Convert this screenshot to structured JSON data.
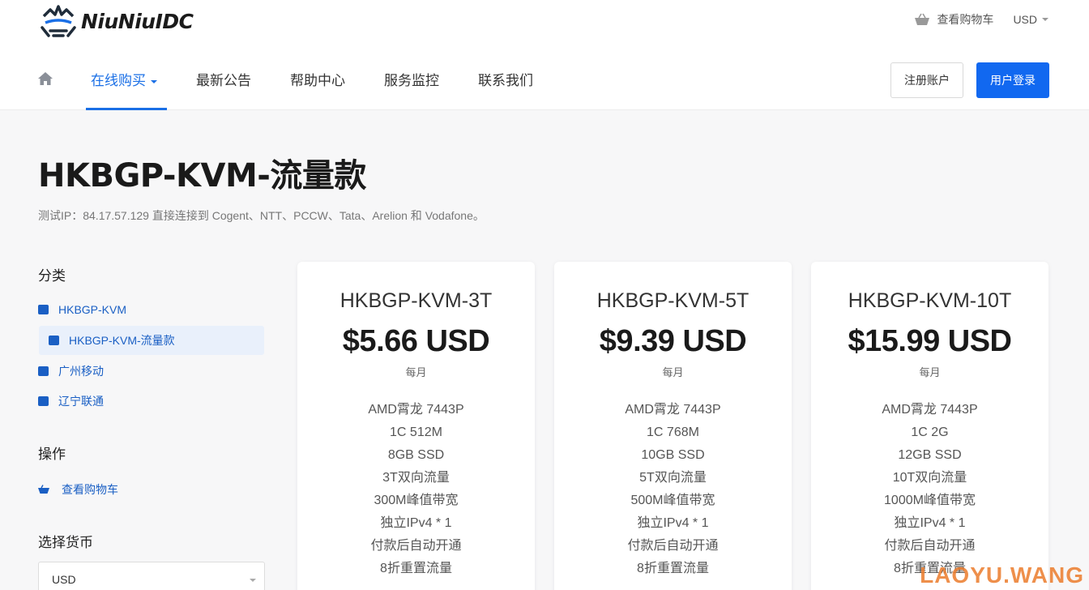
{
  "brand": {
    "name": "NiuNiuIDC"
  },
  "top_links": {
    "cart": "查看购物车",
    "currency": "USD"
  },
  "nav": {
    "items": [
      {
        "label": "在线购买"
      },
      {
        "label": "最新公告"
      },
      {
        "label": "帮助中心"
      },
      {
        "label": "服务监控"
      },
      {
        "label": "联系我们"
      }
    ],
    "register": "注册账户",
    "login": "用户登录"
  },
  "page": {
    "title": "HKBGP-KVM-流量款",
    "subtitle": "测试IP：84.17.57.129 直接连接到 Cogent、NTT、PCCW、Tata、Arelion 和 Vodafone。"
  },
  "sidebar": {
    "categories_heading": "分类",
    "categories": [
      {
        "label": "HKBGP-KVM"
      },
      {
        "label": "HKBGP-KVM-流量款"
      },
      {
        "label": "广州移动"
      },
      {
        "label": "辽宁联通"
      }
    ],
    "actions_heading": "操作",
    "actions": [
      {
        "label": "查看购物车"
      }
    ],
    "currency_heading": "选择货币",
    "currency_value": "USD"
  },
  "products": [
    {
      "name": "HKBGP-KVM-3T",
      "price": "$5.66 USD",
      "cycle": "每月",
      "features": [
        "AMD霄龙 7443P",
        "1C 512M",
        "8GB SSD",
        "3T双向流量",
        "300M峰值带宽",
        "独立IPv4 * 1",
        "付款后自动开通",
        "8折重置流量"
      ]
    },
    {
      "name": "HKBGP-KVM-5T",
      "price": "$9.39 USD",
      "cycle": "每月",
      "features": [
        "AMD霄龙 7443P",
        "1C 768M",
        "10GB SSD",
        "5T双向流量",
        "500M峰值带宽",
        "独立IPv4 * 1",
        "付款后自动开通",
        "8折重置流量"
      ]
    },
    {
      "name": "HKBGP-KVM-10T",
      "price": "$15.99 USD",
      "cycle": "每月",
      "features": [
        "AMD霄龙 7443P",
        "1C 2G",
        "12GB SSD",
        "10T双向流量",
        "1000M峰值带宽",
        "独立IPv4 * 1",
        "付款后自动开通",
        "8折重置流量"
      ]
    }
  ],
  "watermark": "LAOYU.WANG"
}
